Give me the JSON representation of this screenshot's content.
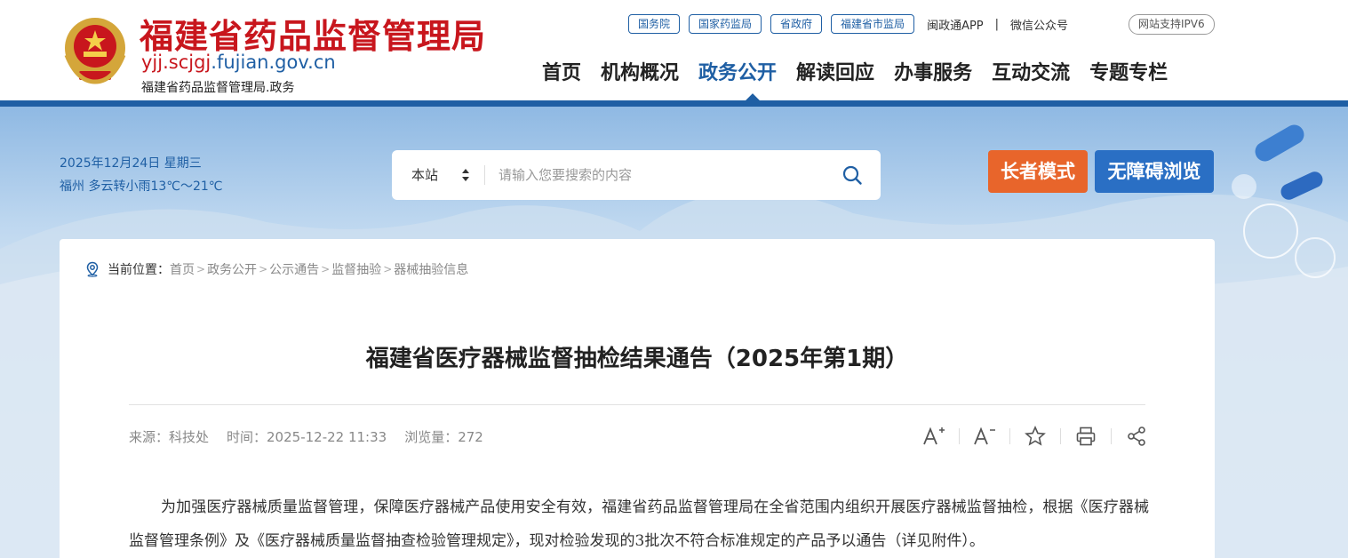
{
  "header": {
    "site_title": "福建省药品监督管理局",
    "domain_red": "yjj.scjgj",
    "domain_blue": ".fujian.gov.cn",
    "site_sub": "福建省药品监督管理局.政务",
    "top_links": [
      "国务院",
      "国家药监局",
      "省政府",
      "福建省市监局"
    ],
    "app_link": "闽政通APP",
    "top_sep": "|",
    "wechat_link": "微信公众号",
    "ipv6_badge": "网站支持IPV6",
    "nav": [
      "首页",
      "机构概况",
      "政务公开",
      "解读回应",
      "办事服务",
      "互动交流",
      "专题专栏"
    ],
    "active_nav": "政务公开"
  },
  "banner": {
    "date": "2025年12月24日 星期三",
    "weather": "福州 多云转小雨13℃～21℃",
    "search_scope": "本站",
    "search_placeholder": "请输入您要搜索的内容",
    "elder_mode": "长者模式",
    "accessible": "无障碍浏览"
  },
  "breadcrumb": {
    "label": "当前位置：",
    "items": [
      "首页",
      "政务公开",
      "公示通告",
      "监督抽验",
      "器械抽验信息"
    ],
    "sep": ">"
  },
  "article": {
    "title": "福建省医疗器械监督抽检结果通告（2025年第1期）",
    "source": "来源：科技处",
    "time": "时间：2025-12-22 11:33",
    "views": "浏览量：272",
    "paragraph": "为加强医疗器械质量监督管理，保障医疗器械产品使用安全有效，福建省药品监督管理局在全省范围内组织开展医疗器械监督抽检，根据《医疗器械监督管理条例》及《医疗器械质量监督抽查检验管理规定》，现对检验发现的3批次不符合标准规定的产品予以通告（详见附件）。"
  },
  "tools": [
    "font-increase-icon",
    "font-decrease-icon",
    "star-icon",
    "print-icon",
    "share-icon"
  ],
  "colors": {
    "brand_red": "#c8161d",
    "brand_blue": "#1f5fa4",
    "elder_orange": "#e8652b",
    "access_blue": "#2a6fc4"
  }
}
